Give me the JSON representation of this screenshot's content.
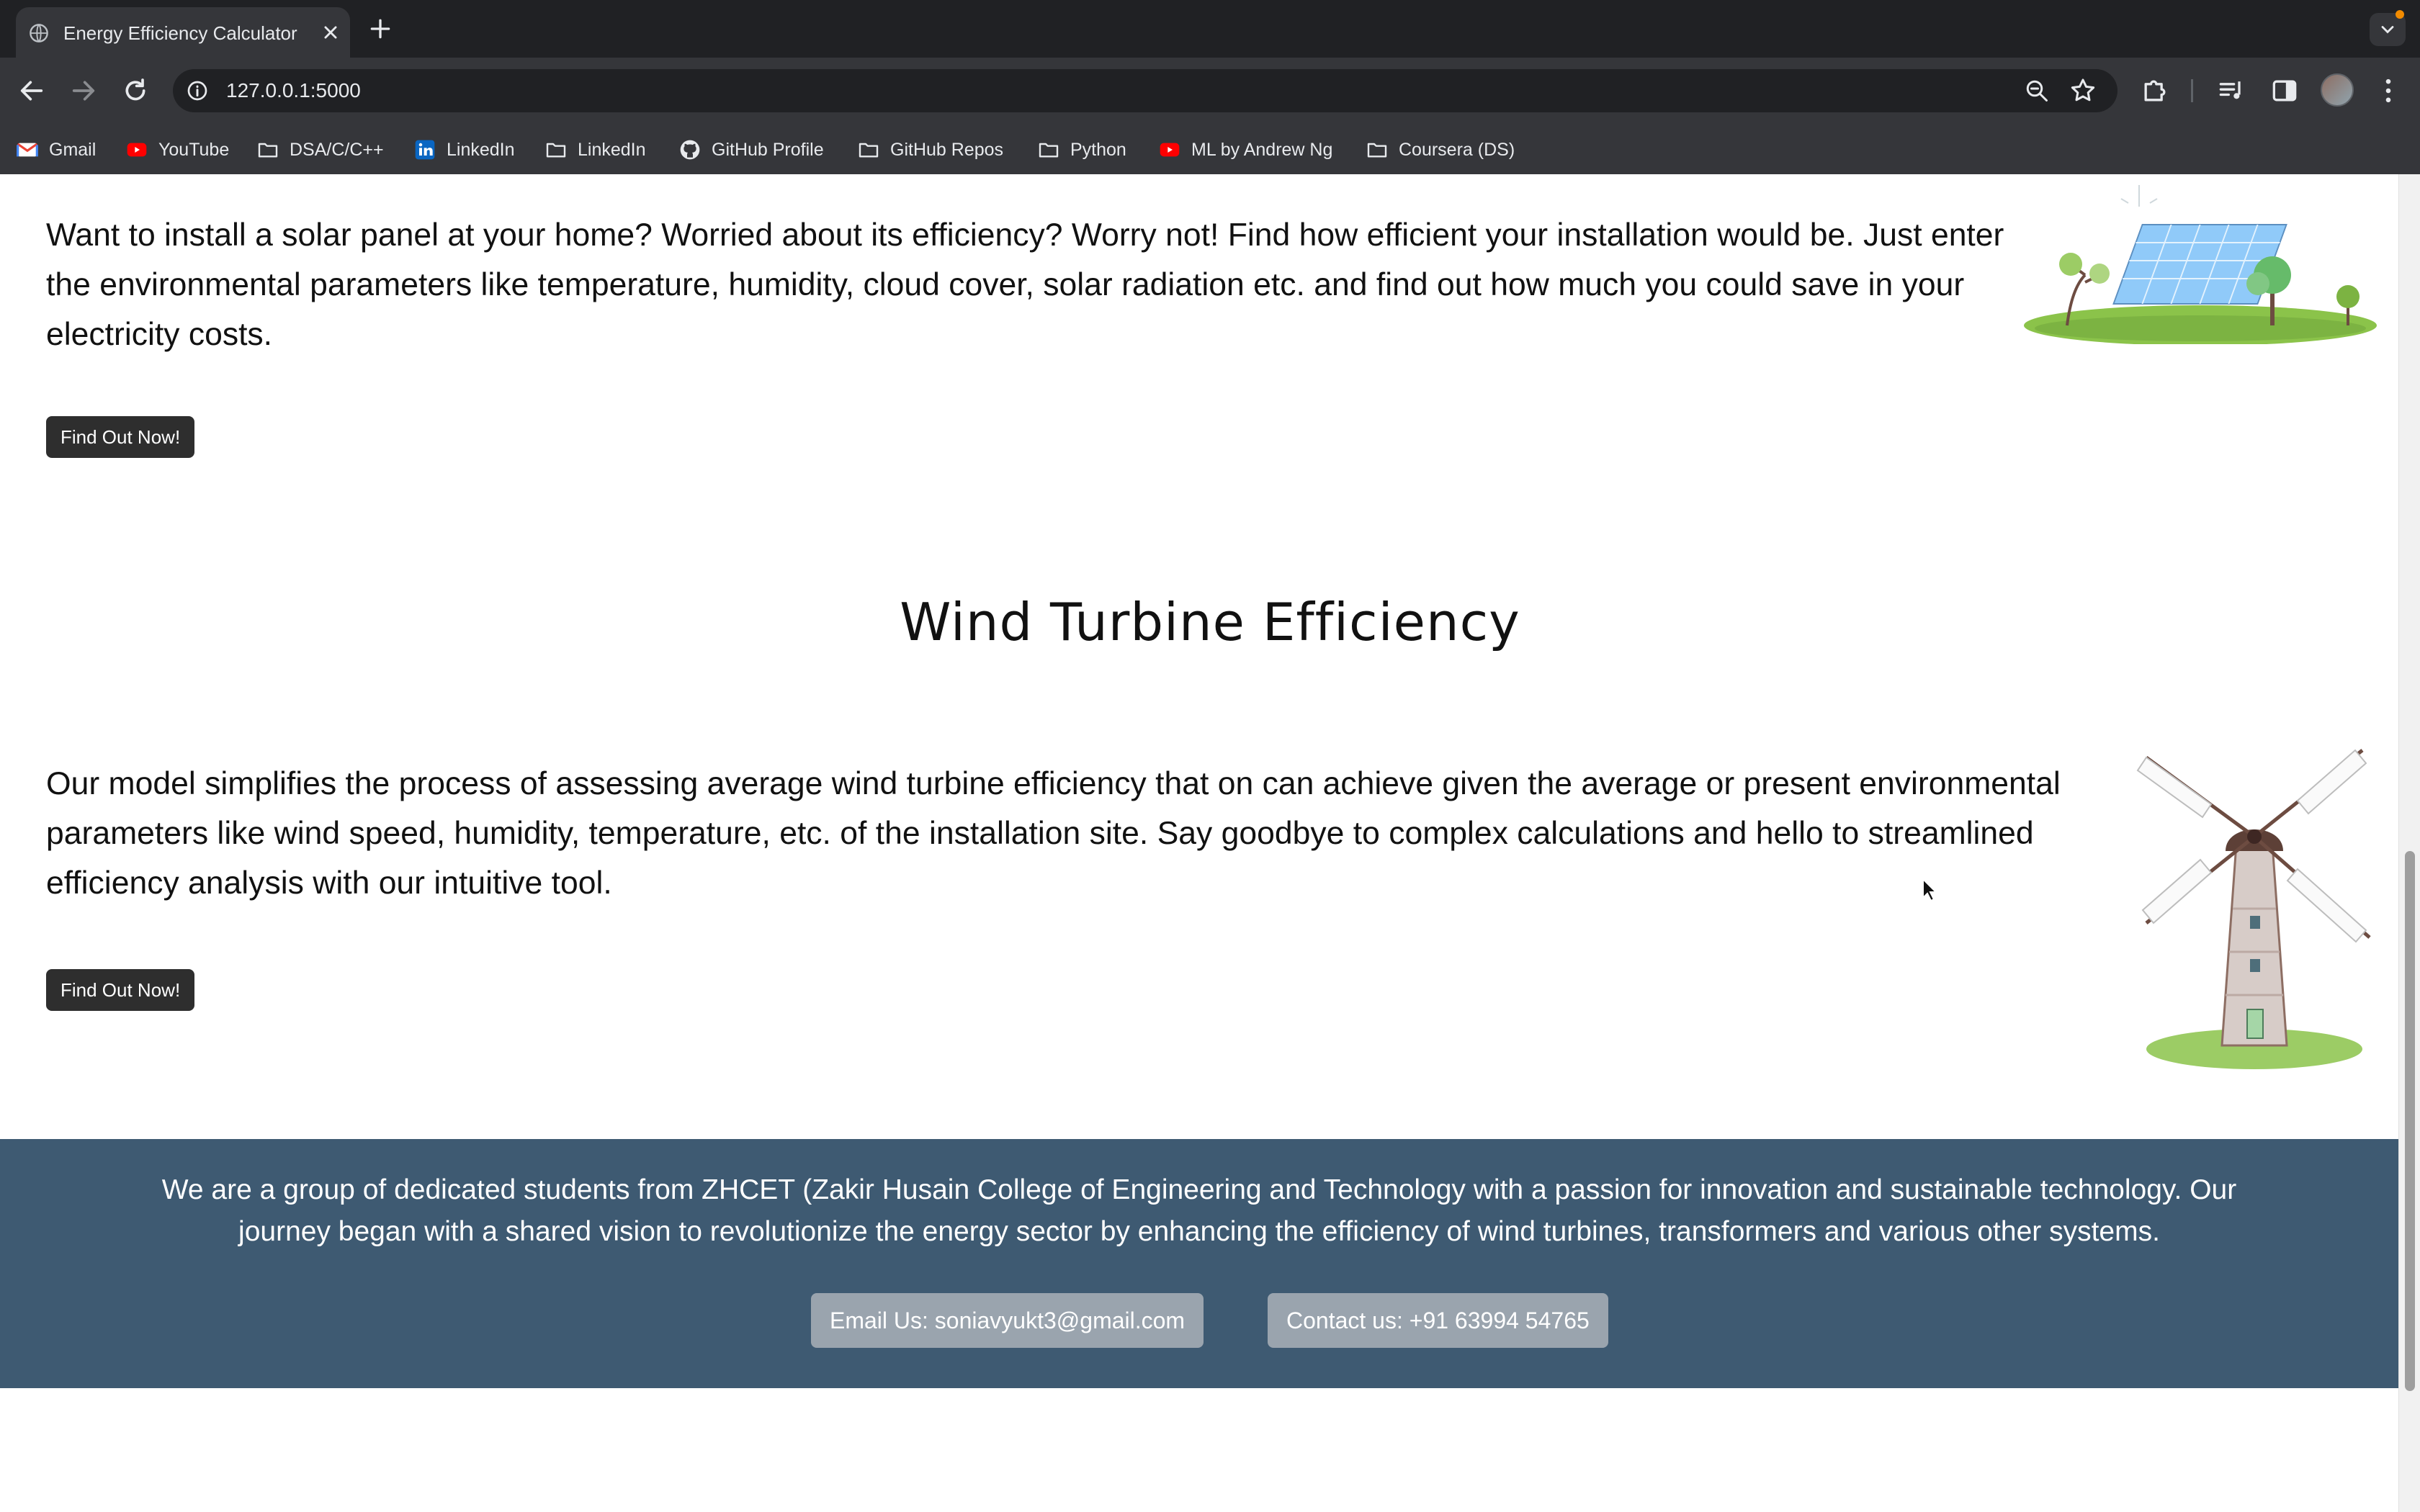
{
  "browser": {
    "tab_title": "Energy Efficiency Calculator",
    "url": "127.0.0.1:5000",
    "bookmarks": [
      {
        "label": "Gmail",
        "icon": "gmail-icon"
      },
      {
        "label": "YouTube",
        "icon": "youtube-icon"
      },
      {
        "label": "DSA/C/C++",
        "icon": "folder-icon"
      },
      {
        "label": "LinkedIn",
        "icon": "linkedin-icon"
      },
      {
        "label": "LinkedIn",
        "icon": "folder-icon"
      },
      {
        "label": "GitHub Profile",
        "icon": "github-icon"
      },
      {
        "label": "GitHub Repos",
        "icon": "folder-icon"
      },
      {
        "label": "Python",
        "icon": "folder-icon"
      },
      {
        "label": "ML by Andrew Ng",
        "icon": "youtube-icon"
      },
      {
        "label": "Coursera (DS)",
        "icon": "folder-icon"
      }
    ]
  },
  "solar": {
    "description": "Want to install a solar panel at your home? Worried about its efficiency? Worry not! Find how efficient your installation would be. Just enter the environmental parameters like temperature, humidity, cloud cover, solar radiation etc. and find out how much you could save in your electricity costs.",
    "button_label": "Find Out Now!"
  },
  "wind": {
    "heading": "Wind Turbine Efficiency",
    "description": "Our model simplifies the process of assessing average wind turbine efficiency that on can achieve given the average or present environmental parameters like wind speed, humidity, temperature, etc. of the installation site. Say goodbye to complex calculations and hello to streamlined efficiency analysis with our intuitive tool.",
    "button_label": "Find Out Now!"
  },
  "footer": {
    "about": "We are a group of dedicated students from ZHCET (Zakir Husain College of Engineering and Technology with a passion for innovation and sustainable technology. Our journey began with a shared vision to revolutionize the energy sector by enhancing the efficiency of wind turbines, transformers and various other systems.",
    "email_label": "Email Us: soniavyukt3@gmail.com",
    "contact_label": "Contact us: +91 63994 54765"
  },
  "colors": {
    "footer_bg": "#3e5a72",
    "button_bg": "#2e2e2e",
    "pill_bg": "#9aa4ae"
  }
}
